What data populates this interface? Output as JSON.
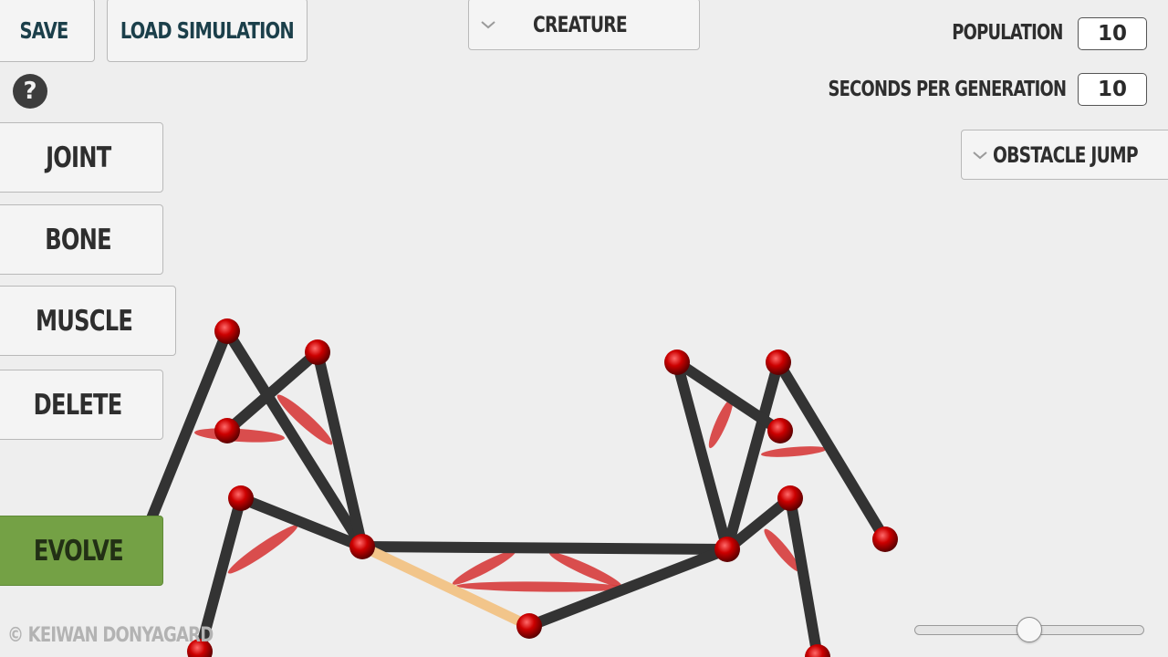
{
  "toolbar": {
    "save_label": "SAVE",
    "load_label": "LOAD SIMULATION",
    "help_label": "?"
  },
  "creature_dropdown": {
    "selected": "CREATURE",
    "icon": "chevron-down-icon"
  },
  "tools": {
    "joint_label": "JOINT",
    "bone_label": "BONE",
    "muscle_label": "MUSCLE",
    "delete_label": "DELETE",
    "evolve_label": "EVOLVE"
  },
  "settings": {
    "population_label": "POPULATION",
    "population_value": "10",
    "seconds_label": "SECONDS PER GENERATION",
    "seconds_value": "10"
  },
  "task_dropdown": {
    "selected": "OBSTACLE JUMP",
    "icon": "chevron-down-icon"
  },
  "footer": {
    "copyright": "© KEIWAN DONYAGARD"
  },
  "speed_slider": {
    "value": 0.5
  },
  "colors": {
    "background": "#eeeeee",
    "evolve_button": "#74a145",
    "bone": "#333333",
    "selected_bone": "#f2c58a",
    "muscle": "#d63b3b",
    "joint": "#cc0000",
    "top_button_text": "#1b3f4a"
  }
}
